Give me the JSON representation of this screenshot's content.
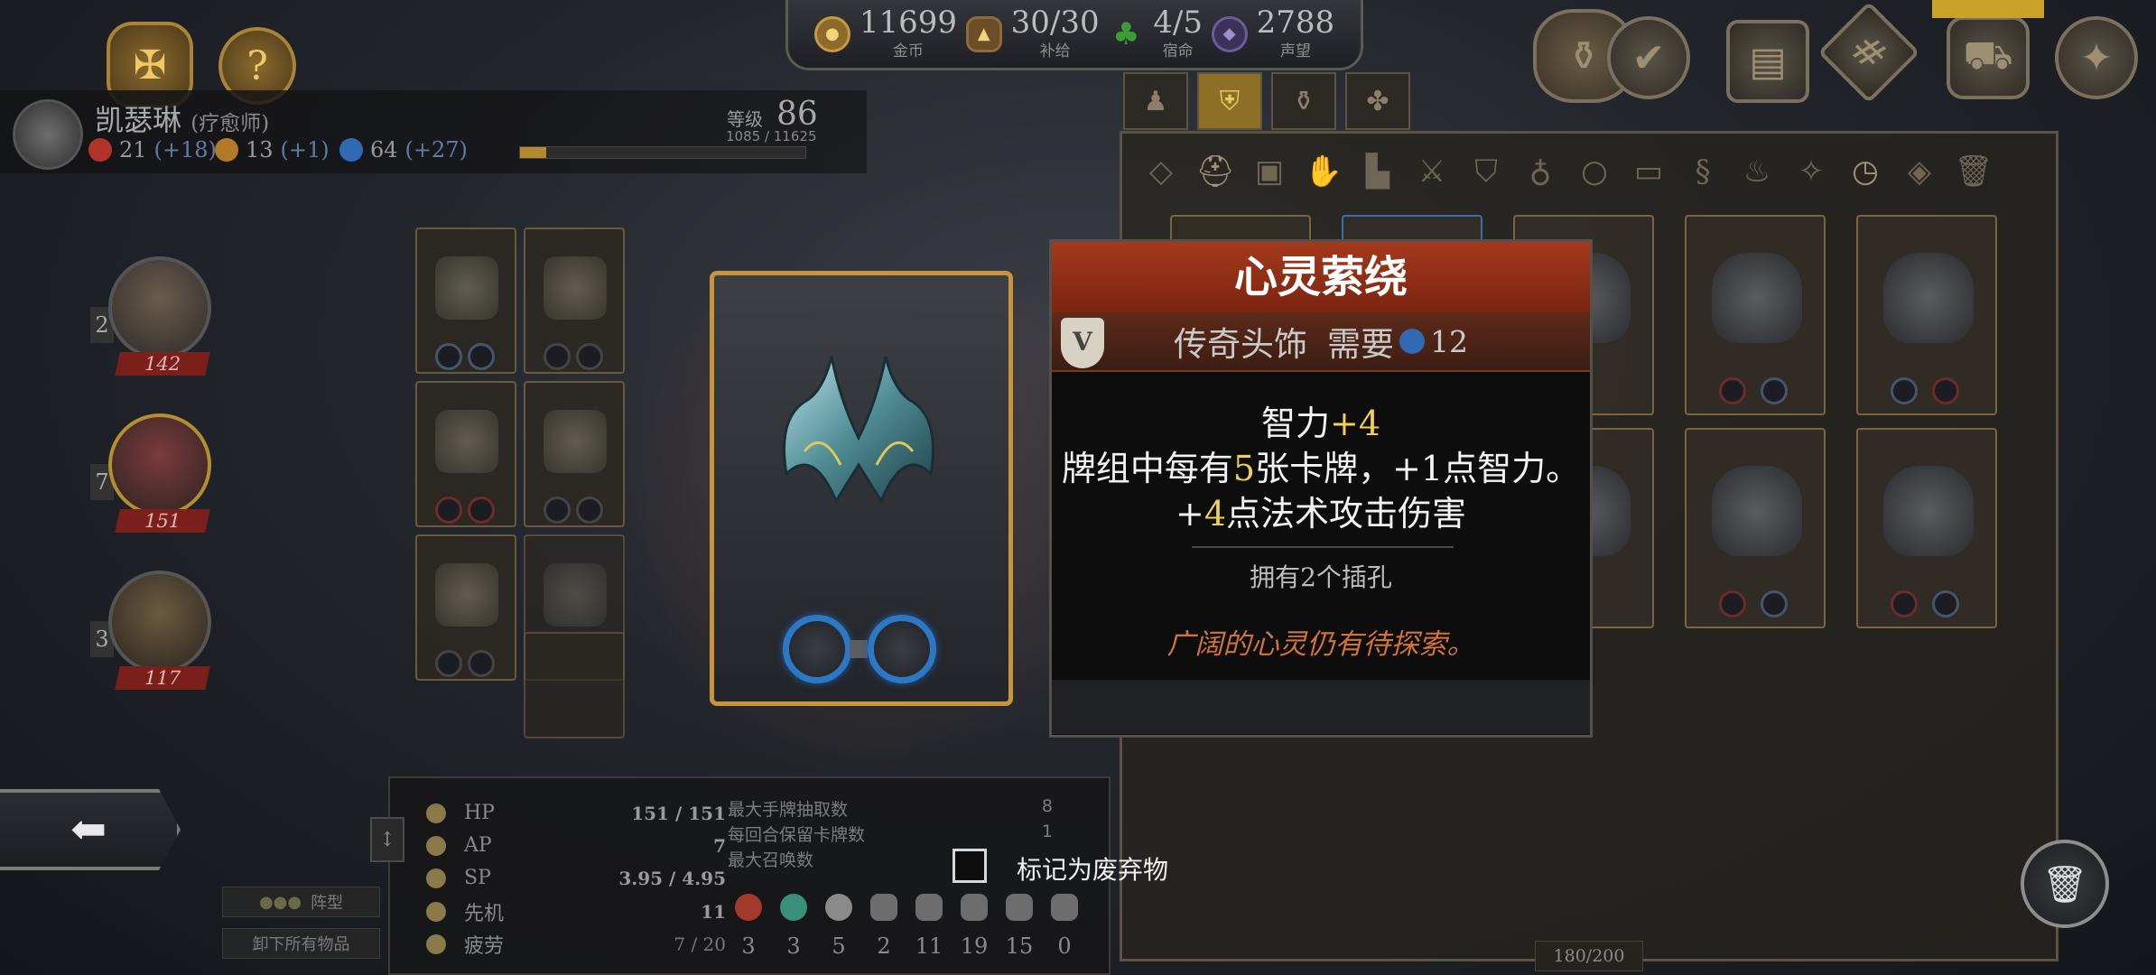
{
  "resources": [
    {
      "value": "11699",
      "label": "金币",
      "icon": "gold-coin-icon"
    },
    {
      "value": "30/30",
      "label": "补给",
      "icon": "supply-bag-icon"
    },
    {
      "value": "4/5",
      "label": "宿命",
      "icon": "clover-icon"
    },
    {
      "value": "2788",
      "label": "声望",
      "icon": "reputation-gem-icon"
    }
  ],
  "character": {
    "name": "凯瑟琳",
    "class": "(疗愈师)",
    "level_label": "等级",
    "level": "86",
    "xp_text": "1085 / 11625",
    "xp_fraction": 0.093,
    "stats": [
      {
        "value": "21",
        "bonus": "(+18)",
        "color": "#b3332a",
        "icon": "strength-icon"
      },
      {
        "value": "13",
        "bonus": "(+1)",
        "color": "#b27a26",
        "icon": "agility-icon"
      },
      {
        "value": "64",
        "bonus": "(+27)",
        "color": "#2f6ab3",
        "icon": "intelligence-icon"
      }
    ]
  },
  "party": [
    {
      "level": "2",
      "hp": "142",
      "active": false
    },
    {
      "level": "7",
      "hp": "151",
      "active": true
    },
    {
      "level": "3",
      "hp": "117",
      "active": false
    }
  ],
  "item_tooltip": {
    "name": "心灵萦绕",
    "rarity_badge": "V",
    "type": "传奇头饰",
    "requirement_label": "需要",
    "requirement_value": "12",
    "line1_prefix": "智力",
    "line1_value": "+4",
    "line2_a": "牌组中每有",
    "line2_num": "5",
    "line2_b": "张卡牌，+1点智力。",
    "line3_prefix": "+",
    "line3_num": "4",
    "line3_b": "点法术攻击伤害",
    "sockets_text": "拥有2个插孔",
    "flavor": "广阔的心灵仍有待探索。"
  },
  "discard": {
    "label": "标记为废弃物"
  },
  "buttons": {
    "formation": "阵型",
    "unequip_all": "卸下所有物品"
  },
  "combat_stats": [
    {
      "name": "HP",
      "value": "151 / 151"
    },
    {
      "name": "AP",
      "value": "7"
    },
    {
      "name": "SP",
      "value": "3.95 / 4.95"
    },
    {
      "name": "先机",
      "value": "11"
    },
    {
      "name": "疲劳",
      "value": "7 / 20"
    }
  ],
  "deck_stats": [
    {
      "name": "最大手牌抽取数",
      "value": "8"
    },
    {
      "name": "每回合保留卡牌数",
      "value": "1"
    },
    {
      "name": "最大召唤数",
      "value": ""
    }
  ],
  "resistances": [
    {
      "value": "3",
      "color": "#a13a2a"
    },
    {
      "value": "3",
      "color": "#3a8f7a"
    },
    {
      "value": "5",
      "color": "#8a8a8a"
    },
    {
      "value": "2",
      "color": "#6d6d6d"
    },
    {
      "value": "11",
      "color": "#6d6d6d"
    },
    {
      "value": "19",
      "color": "#6d6d6d"
    },
    {
      "value": "15",
      "color": "#6d6d6d"
    },
    {
      "value": "0",
      "color": "#6d6d6d"
    }
  ],
  "inventory": {
    "capacity": "180/200"
  }
}
